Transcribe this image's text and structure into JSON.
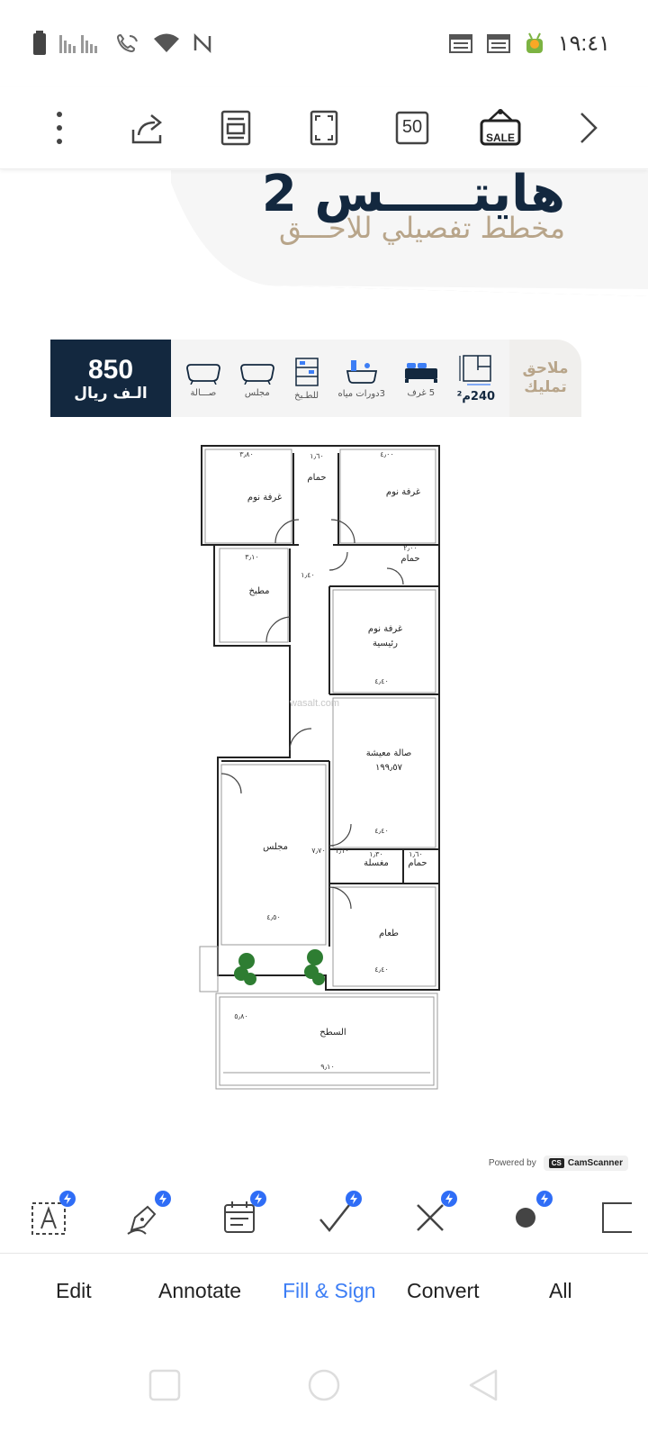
{
  "status_bar": {
    "time": "١٩:٤١"
  },
  "toolbar": {
    "zoom_value": "50",
    "sale_label": "SALE"
  },
  "document": {
    "title": "هايتـــــس 2",
    "subtitle": "مخطط تفصيلي للاحـــق",
    "price": {
      "value": "850",
      "unit": "الـف ريال"
    },
    "features": [
      {
        "label": "صـــالة",
        "icon": "bathtub-icon"
      },
      {
        "label": "مجلس",
        "icon": "bathtub-icon"
      },
      {
        "label": "للطـبخ",
        "icon": "kitchen-icon"
      },
      {
        "label": "3دورات مياه",
        "icon": "bathroom-icon"
      },
      {
        "label": "5 غرف",
        "icon": "bed-icon"
      },
      {
        "label": "240م²",
        "icon": "area-icon"
      }
    ],
    "annex": {
      "line1": "ملاحق",
      "line2": "تمليك"
    },
    "floor_plan": {
      "rooms": {
        "bedroom_1": "غرفة نوم",
        "bedroom_2": "غرفة نوم",
        "bath_1": "حمام",
        "bath_2": "حمام",
        "kitchen": "مطبخ",
        "master_1": "غرفة نوم",
        "master_2": "رئيسية",
        "living_1": "صالة معيشة",
        "living_2": "١٩٩٫٥٧",
        "majlis": "مجلس",
        "laundry": "مغسلة",
        "bath_3": "حمام",
        "dining": "طعام",
        "roof": "السطح"
      },
      "dims": {
        "d1": "٣٫٨٠",
        "d2": "١٫٦٠",
        "d3": "٤٫٠٠",
        "d4": "٣٫١٠",
        "d5": "٢٫٠٠",
        "d6": "١٫٤٠",
        "d7": "٤٫٤٠",
        "d8": "٤٫٤٠",
        "d9": "٧٫٧٠",
        "d10": "١٫١٠",
        "d11": "١٫٣٠",
        "d12": "١٫٦٠",
        "d13": "٤٫٥٠",
        "d14": "٤٫٤٠",
        "d15": "٥٫٨٠",
        "d16": "٩٫١٠"
      }
    },
    "watermark": "wasalt.com"
  },
  "powered_by": {
    "text": "Powered by",
    "brand": "CamScanner",
    "brand_mark": "CS"
  },
  "tools": [
    {
      "name": "text-box-tool",
      "icon": "text-box-icon"
    },
    {
      "name": "signature-tool",
      "icon": "pen-icon"
    },
    {
      "name": "date-tool",
      "icon": "calendar-icon"
    },
    {
      "name": "check-tool",
      "icon": "check-icon"
    },
    {
      "name": "cross-tool",
      "icon": "cross-icon"
    },
    {
      "name": "dot-tool",
      "icon": "dot-icon"
    },
    {
      "name": "rect-tool",
      "icon": "rectangle-icon"
    }
  ],
  "tabs": [
    {
      "label": "Edit",
      "active": false
    },
    {
      "label": "Annotate",
      "active": false
    },
    {
      "label": "Fill & Sign",
      "active": true
    },
    {
      "label": "Convert",
      "active": false
    },
    {
      "label": "All",
      "active": false
    }
  ],
  "colors": {
    "navy": "#13283f",
    "gold": "#b8a58a",
    "accent_blue": "#3d7ef5",
    "badge_blue": "#2f6df6"
  }
}
